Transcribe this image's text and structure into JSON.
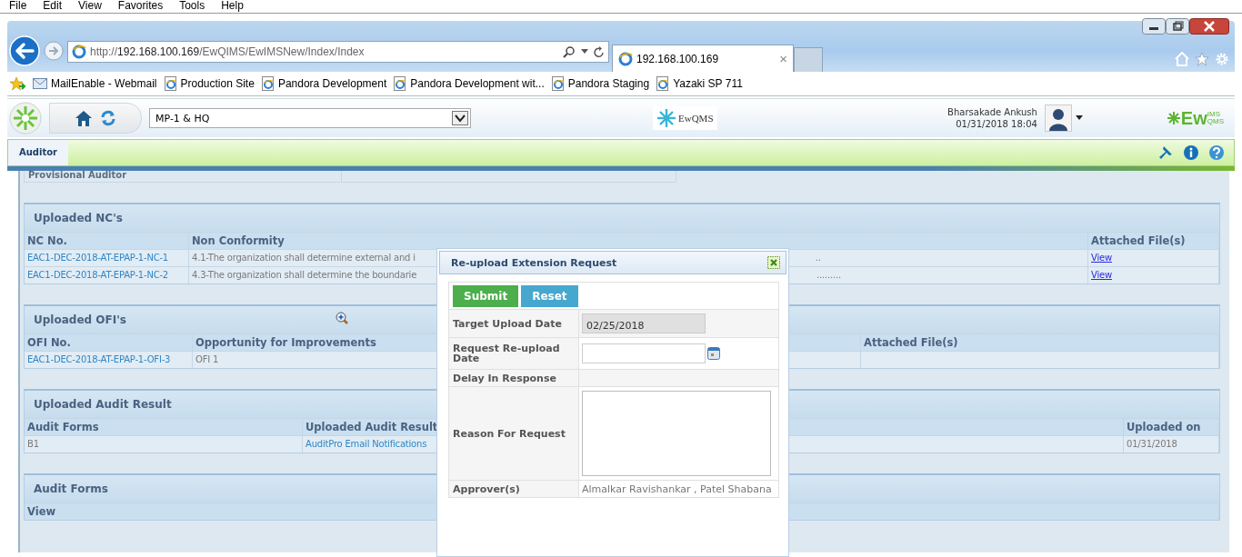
{
  "menu_bar": [
    "File",
    "Edit",
    "View",
    "Favorites",
    "Tools",
    "Help"
  ],
  "browser": {
    "address": "http://**192.168.100.169**/EwQIMS/EwIMSNew/Index/Index",
    "tab": {
      "title": "192.168.100.169",
      "close": "×"
    },
    "favorites": [
      "MailEnable - Webmail",
      "Production Site",
      "Pandora Development",
      "Pandora Development wit...",
      "Pandora Staging",
      "Yazaki SP 711"
    ]
  },
  "app_header": {
    "location": "MP-1 & HQ",
    "logo": "EwQMS",
    "user": "Bharsakade Ankush",
    "datetime": "01/31/2018 18:04",
    "brand": {
      "main": "Ew",
      "upper": "IMS",
      "lower": "QMS"
    }
  },
  "nav": {
    "tabs": [
      {
        "label": "Auditor",
        "selected": true
      }
    ]
  },
  "provisional": {
    "label": "Provisional Auditor"
  },
  "panels": [
    {
      "title": "Uploaded NC's",
      "columns": [
        "NC No.",
        "Non Conformity",
        "Attached File(s)"
      ],
      "rows": [
        {
          "cells": [
            "EAC1-DEC-2018-AT-EPAP-1-NC-1",
            "4.1-The organization shall determine external and i",
            "View"
          ],
          "tail": ".."
        },
        {
          "cells": [
            "EAC1-DEC-2018-AT-EPAP-1-NC-2",
            "4.3-The organization shall determine the boundarie",
            "View"
          ],
          "tail": "........."
        }
      ]
    },
    {
      "title": "Uploaded OFI's",
      "columns": [
        "OFI No.",
        "Opportunity for Improvements",
        "Attached File(s)"
      ],
      "rows": [
        {
          "cells": [
            "EAC1-DEC-2018-AT-EPAP-1-OFI-3",
            "OFI 1",
            ""
          ]
        }
      ]
    },
    {
      "title": "Uploaded Audit Result",
      "columns": [
        "Audit Forms",
        "Uploaded Audit Result",
        "Uploaded on"
      ],
      "rows": [
        {
          "cells": [
            "B1",
            "AuditPro Email Notifications",
            "01/31/2018"
          ]
        }
      ]
    },
    {
      "title": "Audit Forms",
      "columns": [
        "View"
      ]
    }
  ],
  "modal": {
    "title": "Re-upload Extension Request",
    "buttons": [
      {
        "label": "Submit",
        "kind": "primary"
      },
      {
        "label": "Reset",
        "kind": "secondary"
      }
    ],
    "fields": [
      {
        "label": "Target Upload Date",
        "kind": "readonly",
        "value": "02/25/2018"
      },
      {
        "label": "Request Re-upload Date",
        "kind": "date"
      },
      {
        "label": "Delay In Response",
        "kind": "empty"
      },
      {
        "label": "Reason For Request",
        "kind": "textarea"
      },
      {
        "label": "Approver(s)",
        "kind": "text",
        "value": "Almalkar Ravishankar , Patel Shabana"
      }
    ]
  }
}
